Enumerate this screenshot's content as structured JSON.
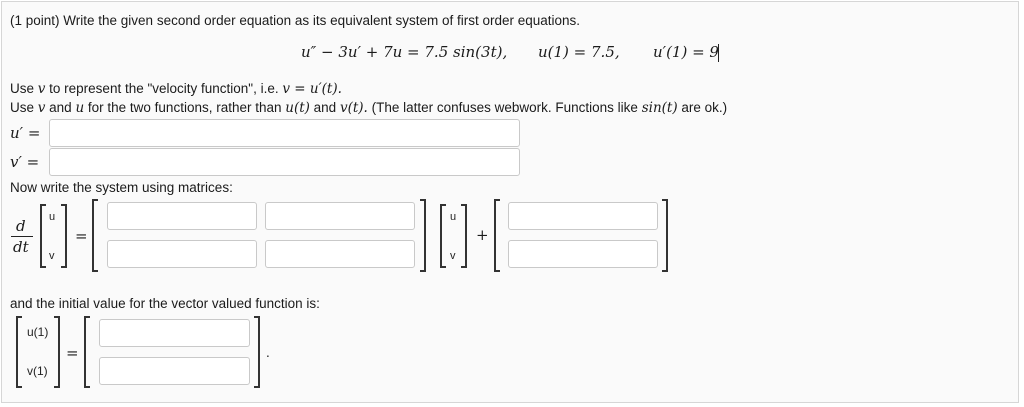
{
  "problem": {
    "header": "(1 point) Write the given second order equation as its equivalent system of first order equations.",
    "equation": "u″ − 3u′ + 7u = 7.5 sin(3t),",
    "ic1": "u(1) = 7.5,",
    "ic2": "u′(1) = 9",
    "line1_prefix": "Use ",
    "line1_var": "v",
    "line1_mid": " to represent the \"velocity function\", i.e. ",
    "line1_math": "v = u′(t).",
    "line2_a": "Use ",
    "line2_v": "v",
    "line2_b": " and ",
    "line2_u": "u",
    "line2_c": " for the two functions, rather than ",
    "line2_ut": "u(t)",
    "line2_d": " and ",
    "line2_vt": "v(t).",
    "line2_e": " (The latter confuses webwork. Functions like ",
    "line2_sin": "sin(t)",
    "line2_f": " are ok.)",
    "uprime_label": "u′ =",
    "vprime_label": "v′ =",
    "matrix_heading": "Now write the system using matrices:",
    "d_label": "d",
    "dt_label": "dt",
    "vec_u": "u",
    "vec_v": "v",
    "eq_sign": "=",
    "plus_sign": "+",
    "initial_heading": "and the initial value for the vector valued function is:",
    "iv_u1": "u(1)",
    "iv_v1": "v(1)",
    "period": "."
  },
  "inputs": {
    "uprime": "",
    "vprime": "",
    "a11": "",
    "a12": "",
    "a21": "",
    "a22": "",
    "b1": "",
    "b2": "",
    "iv1": "",
    "iv2": ""
  }
}
